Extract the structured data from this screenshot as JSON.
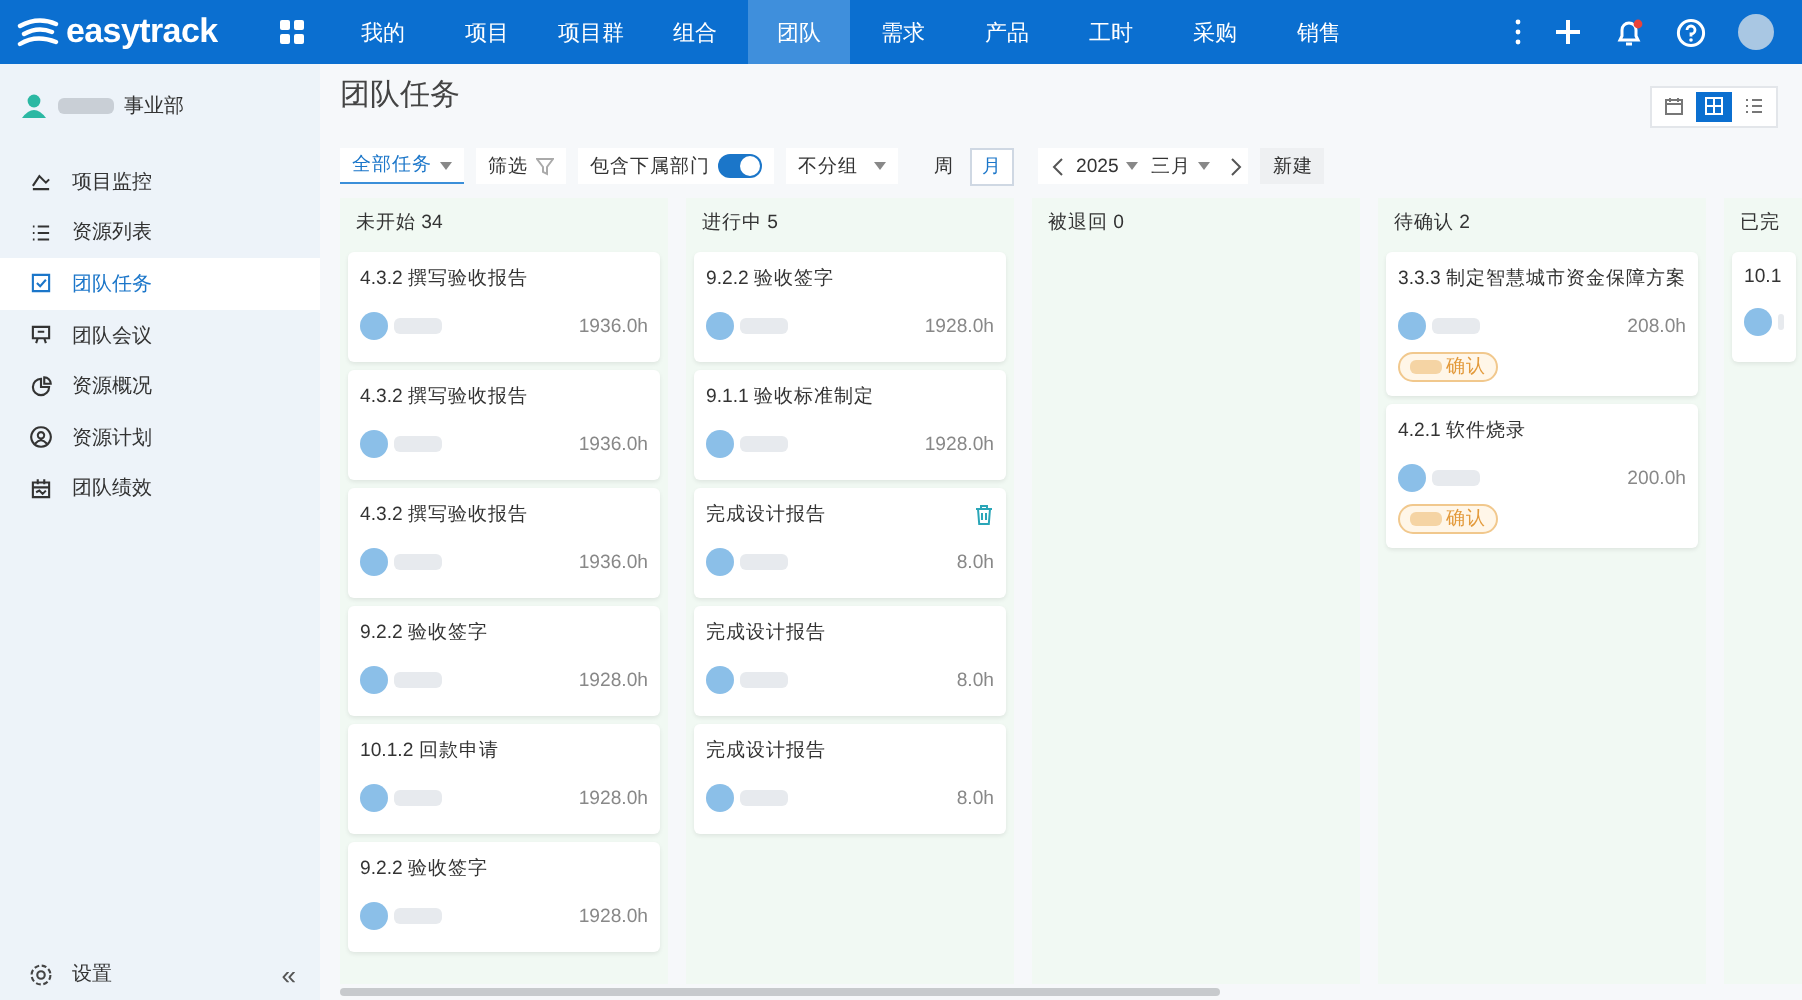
{
  "topbar": {
    "logo": "easytrack",
    "nav": [
      {
        "label": "我的",
        "selected": false
      },
      {
        "label": "项目",
        "selected": false
      },
      {
        "label": "项目群",
        "selected": false
      },
      {
        "label": "组合",
        "selected": false
      },
      {
        "label": "团队",
        "selected": true
      },
      {
        "label": "需求",
        "selected": false
      },
      {
        "label": "产品",
        "selected": false
      },
      {
        "label": "工时",
        "selected": false
      },
      {
        "label": "采购",
        "selected": false
      },
      {
        "label": "销售",
        "selected": false
      }
    ],
    "notification_dot": true
  },
  "sidebar": {
    "department": "事业部",
    "items": [
      {
        "label": "项目监控",
        "selected": false
      },
      {
        "label": "资源列表",
        "selected": false
      },
      {
        "label": "团队任务",
        "selected": true
      },
      {
        "label": "团队会议",
        "selected": false
      },
      {
        "label": "资源概况",
        "selected": false
      },
      {
        "label": "资源计划",
        "selected": false
      },
      {
        "label": "团队绩效",
        "selected": false
      }
    ],
    "settings": "设置",
    "collapse": "«"
  },
  "page": {
    "title": "团队任务",
    "views": [
      {
        "kind": "calendar",
        "selected": false
      },
      {
        "kind": "board",
        "selected": true
      },
      {
        "kind": "list",
        "selected": false
      }
    ]
  },
  "toolbar": {
    "scope": "全部任务",
    "filter": "筛选",
    "include_sub": {
      "label": "包含下属部门",
      "on": true
    },
    "group": "不分组",
    "periods": [
      {
        "label": "周",
        "selected": false
      },
      {
        "label": "月",
        "selected": true
      }
    ],
    "year": "2025",
    "month": "三月",
    "new": "新建"
  },
  "columns": [
    {
      "title": "未开始 34",
      "cards": [
        {
          "title": "4.3.2 撰写验收报告",
          "hours": "1936.0h",
          "show_delete": false
        },
        {
          "title": "4.3.2 撰写验收报告",
          "hours": "1936.0h",
          "show_delete": false
        },
        {
          "title": "4.3.2 撰写验收报告",
          "hours": "1936.0h",
          "show_delete": false
        },
        {
          "title": "9.2.2 验收签字",
          "hours": "1928.0h",
          "show_delete": false
        },
        {
          "title": "10.1.2 回款申请",
          "hours": "1928.0h",
          "show_delete": false
        },
        {
          "title": "9.2.2 验收签字",
          "hours": "1928.0h",
          "show_delete": false
        }
      ]
    },
    {
      "title": "进行中 5",
      "cards": [
        {
          "title": "9.2.2 验收签字",
          "hours": "1928.0h",
          "show_delete": false
        },
        {
          "title": "9.1.1 验收标准制定",
          "hours": "1928.0h",
          "show_delete": false
        },
        {
          "title": "完成设计报告",
          "hours": "8.0h",
          "show_delete": true
        },
        {
          "title": "完成设计报告",
          "hours": "8.0h",
          "show_delete": false
        },
        {
          "title": "完成设计报告",
          "hours": "8.0h",
          "show_delete": false
        }
      ]
    },
    {
      "title": "被退回 0"
    },
    {
      "title": "待确认 2",
      "cards": [
        {
          "title": "3.3.3 制定智慧城市资金保障方案",
          "hours": "208.0h",
          "show_delete": false,
          "tag": "确认"
        },
        {
          "title": "4.2.1 软件烧录",
          "hours": "200.0h",
          "show_delete": false,
          "tag": "确认"
        }
      ]
    },
    {
      "title": "已完",
      "cards": [
        {
          "title": "10.1",
          "show_delete": false
        }
      ]
    }
  ]
}
